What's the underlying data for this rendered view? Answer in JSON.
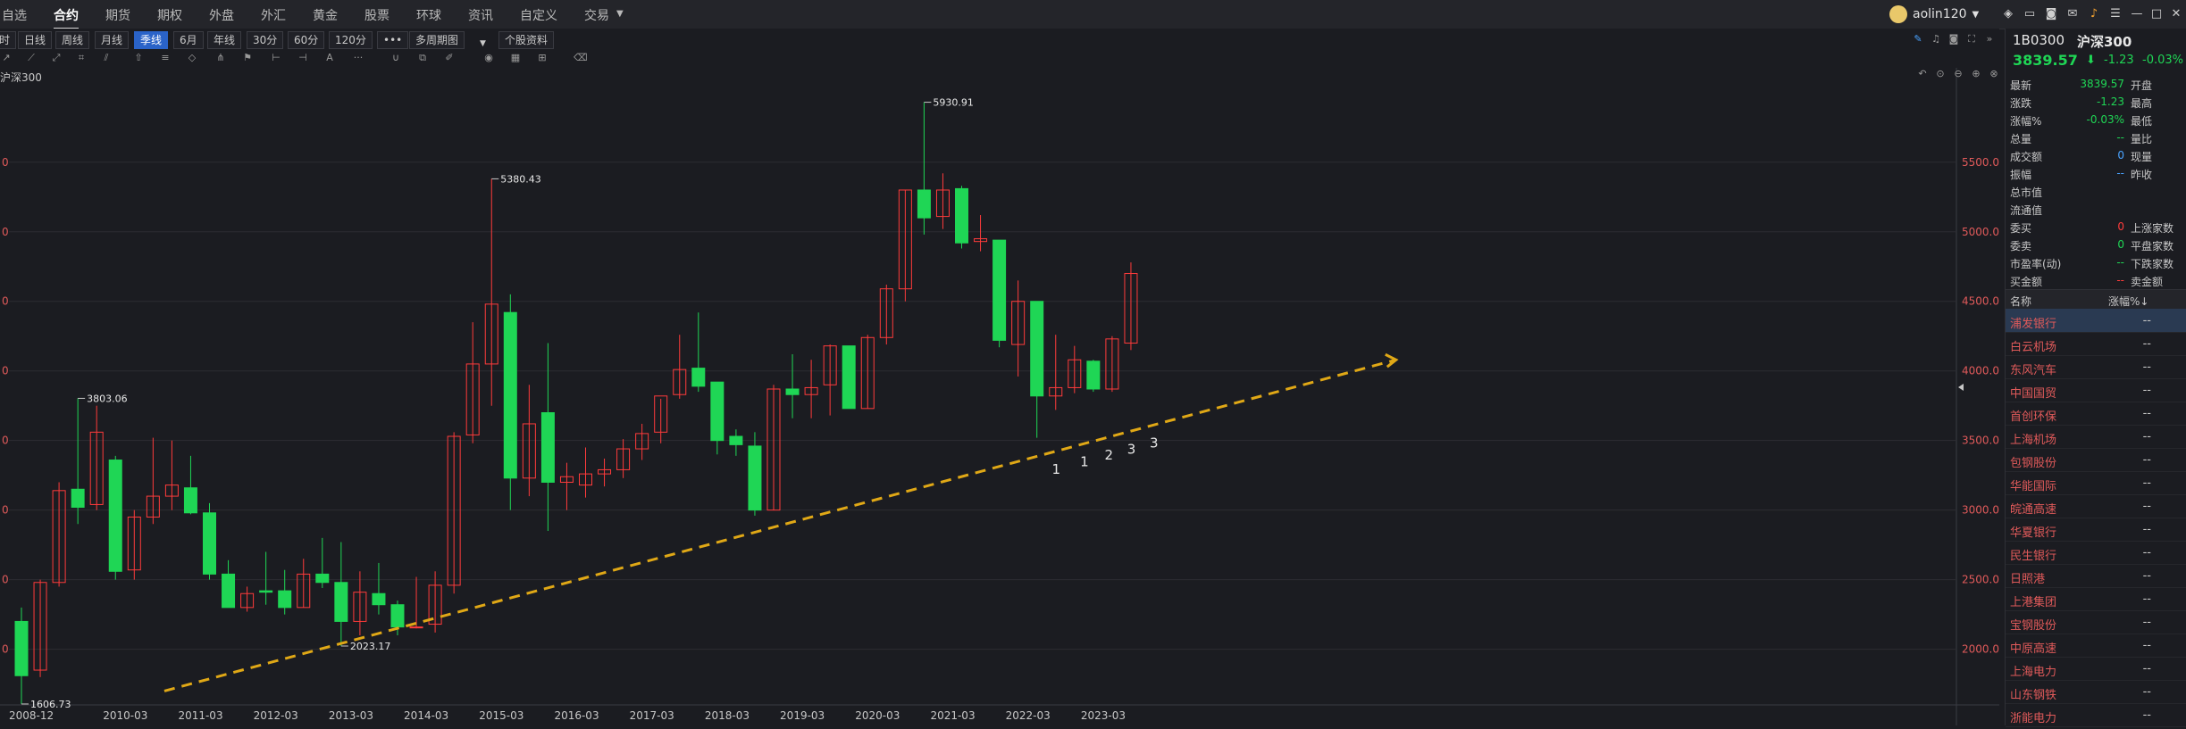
{
  "nav": {
    "items": [
      "自选",
      "合约",
      "期货",
      "期权",
      "外盘",
      "外汇",
      "黄金",
      "股票",
      "环球",
      "资讯",
      "自定义",
      "交易"
    ],
    "active": "合约",
    "user": "aolin120"
  },
  "periods": {
    "items": [
      "分时",
      "日线",
      "周线",
      "月线",
      "季线",
      "6月",
      "年线",
      "30分",
      "60分",
      "120分",
      "•••",
      "多周期图",
      "个股资料"
    ],
    "active": "季线"
  },
  "chart": {
    "label": "沪深300",
    "colors": {
      "up": "#ff3b3b",
      "down": "#1fd655",
      "trend": "#e0a816",
      "bg": "#1b1c21",
      "grid": "#2c2d33"
    }
  },
  "chart_data": {
    "type": "candlestick",
    "title": "沪深300",
    "x_ticks": [
      "2008-12",
      "2010-03",
      "2011-03",
      "2012-03",
      "2013-03",
      "2014-03",
      "2015-03",
      "2016-03",
      "2017-03",
      "2018-03",
      "2019-03",
      "2020-03",
      "2021-03",
      "2022-03",
      "2023-03"
    ],
    "y_ticks": [
      2000,
      2500,
      3000,
      3500,
      4000,
      4500,
      5000,
      5500
    ],
    "ylim": [
      1600,
      6050
    ],
    "candles": [
      {
        "o": 2200,
        "h": 2300,
        "l": 1606.73,
        "c": 1810
      },
      {
        "o": 1850,
        "h": 2500,
        "l": 1800,
        "c": 2480
      },
      {
        "o": 2480,
        "h": 3200,
        "l": 2450,
        "c": 3140
      },
      {
        "o": 3150,
        "h": 3803.06,
        "l": 2900,
        "c": 3020
      },
      {
        "o": 3040,
        "h": 3750,
        "l": 3000,
        "c": 3560
      },
      {
        "o": 3360,
        "h": 3390,
        "l": 2500,
        "c": 2560
      },
      {
        "o": 2570,
        "h": 3000,
        "l": 2500,
        "c": 2950
      },
      {
        "o": 2950,
        "h": 3520,
        "l": 2900,
        "c": 3100
      },
      {
        "o": 3100,
        "h": 3500,
        "l": 3000,
        "c": 3180
      },
      {
        "o": 3160,
        "h": 3390,
        "l": 2970,
        "c": 2980
      },
      {
        "o": 2980,
        "h": 3050,
        "l": 2500,
        "c": 2540
      },
      {
        "o": 2540,
        "h": 2640,
        "l": 2340,
        "c": 2300
      },
      {
        "o": 2300,
        "h": 2450,
        "l": 2270,
        "c": 2400
      },
      {
        "o": 2420,
        "h": 2700,
        "l": 2320,
        "c": 2410
      },
      {
        "o": 2420,
        "h": 2570,
        "l": 2250,
        "c": 2300
      },
      {
        "o": 2300,
        "h": 2650,
        "l": 2300,
        "c": 2540
      },
      {
        "o": 2540,
        "h": 2800,
        "l": 2440,
        "c": 2480
      },
      {
        "o": 2480,
        "h": 2770,
        "l": 2023.17,
        "c": 2200
      },
      {
        "o": 2200,
        "h": 2560,
        "l": 2100,
        "c": 2410
      },
      {
        "o": 2400,
        "h": 2620,
        "l": 2250,
        "c": 2320
      },
      {
        "o": 2320,
        "h": 2350,
        "l": 2100,
        "c": 2160
      },
      {
        "o": 2160,
        "h": 2520,
        "l": 2150,
        "c": 2160
      },
      {
        "o": 2180,
        "h": 2560,
        "l": 2120,
        "c": 2460
      },
      {
        "o": 2460,
        "h": 3560,
        "l": 2400,
        "c": 3530
      },
      {
        "o": 3540,
        "h": 4350,
        "l": 3480,
        "c": 4050
      },
      {
        "o": 4050,
        "h": 5380.43,
        "l": 3750,
        "c": 4480
      },
      {
        "o": 4420,
        "h": 4550,
        "l": 3000,
        "c": 3230
      },
      {
        "o": 3230,
        "h": 3900,
        "l": 3100,
        "c": 3620
      },
      {
        "o": 3700,
        "h": 4200,
        "l": 2850,
        "c": 3200
      },
      {
        "o": 3200,
        "h": 3340,
        "l": 3000,
        "c": 3240
      },
      {
        "o": 3180,
        "h": 3450,
        "l": 3090,
        "c": 3260
      },
      {
        "o": 3260,
        "h": 3370,
        "l": 3170,
        "c": 3290
      },
      {
        "o": 3290,
        "h": 3510,
        "l": 3230,
        "c": 3440
      },
      {
        "o": 3440,
        "h": 3620,
        "l": 3360,
        "c": 3550
      },
      {
        "o": 3560,
        "h": 3800,
        "l": 3480,
        "c": 3820
      },
      {
        "o": 3830,
        "h": 4260,
        "l": 3800,
        "c": 4010
      },
      {
        "o": 4020,
        "h": 4420,
        "l": 3850,
        "c": 3890
      },
      {
        "o": 3920,
        "h": 3920,
        "l": 3400,
        "c": 3500
      },
      {
        "o": 3530,
        "h": 3580,
        "l": 3390,
        "c": 3470
      },
      {
        "o": 3460,
        "h": 3560,
        "l": 2960,
        "c": 3000
      },
      {
        "o": 3000,
        "h": 3900,
        "l": 3000,
        "c": 3870
      },
      {
        "o": 3870,
        "h": 4120,
        "l": 3660,
        "c": 3830
      },
      {
        "o": 3830,
        "h": 4080,
        "l": 3660,
        "c": 3880
      },
      {
        "o": 3900,
        "h": 4190,
        "l": 3680,
        "c": 4180
      },
      {
        "o": 4180,
        "h": 4180,
        "l": 3730,
        "c": 3730
      },
      {
        "o": 3730,
        "h": 4260,
        "l": 3730,
        "c": 4240
      },
      {
        "o": 4240,
        "h": 4620,
        "l": 4190,
        "c": 4590
      },
      {
        "o": 4590,
        "h": 5300,
        "l": 4500,
        "c": 5300
      },
      {
        "o": 5300,
        "h": 5930.91,
        "l": 4980,
        "c": 5100
      },
      {
        "o": 5110,
        "h": 5420,
        "l": 5020,
        "c": 5300
      },
      {
        "o": 5310,
        "h": 5330,
        "l": 4880,
        "c": 4920
      },
      {
        "o": 4930,
        "h": 5120,
        "l": 4860,
        "c": 4950
      },
      {
        "o": 4940,
        "h": 4940,
        "l": 4170,
        "c": 4220
      },
      {
        "o": 4190,
        "h": 4650,
        "l": 3960,
        "c": 4500
      },
      {
        "o": 4500,
        "h": 4500,
        "l": 3520,
        "c": 3820
      },
      {
        "o": 3820,
        "h": 4260,
        "l": 3720,
        "c": 3880
      },
      {
        "o": 3880,
        "h": 4180,
        "l": 3840,
        "c": 4080
      },
      {
        "o": 4070,
        "h": 4080,
        "l": 3850,
        "c": 3870
      },
      {
        "o": 3870,
        "h": 4250,
        "l": 3850,
        "c": 4230
      },
      {
        "o": 4200,
        "h": 4780,
        "l": 4150,
        "c": 4700
      }
    ],
    "annotations": [
      {
        "text": "1606.73",
        "x": 0,
        "y": 1606.73
      },
      {
        "text": "3803.06",
        "x": 3,
        "y": 3803.06
      },
      {
        "text": "2023.17",
        "x": 17,
        "y": 2023.17
      },
      {
        "text": "5380.43",
        "x": 25,
        "y": 5380.43
      },
      {
        "text": "5930.91",
        "x": 48,
        "y": 5930.91
      }
    ],
    "wave_labels": [
      {
        "text": "1",
        "x": 54.8
      },
      {
        "text": "1",
        "x": 56.3
      },
      {
        "text": "2",
        "x": 57.6
      },
      {
        "text": "3",
        "x": 58.8
      },
      {
        "text": "3",
        "x": 60.0
      }
    ],
    "trendline": {
      "from": {
        "x": 7.6,
        "y": 1700
      },
      "to": {
        "x": 73.1,
        "y": 4080
      }
    }
  },
  "quote": {
    "code": "1B0300",
    "name": "沪深300",
    "price": "3839.57",
    "change": "-1.23",
    "change_pct": "-0.03%",
    "rows": [
      {
        "l": "最新",
        "v": "3839.57",
        "r": "开盘",
        "c": "#1fd655"
      },
      {
        "l": "涨跌",
        "v": "-1.23",
        "r": "最高",
        "c": "#1fd655"
      },
      {
        "l": "涨幅%",
        "v": "-0.03%",
        "r": "最低",
        "c": "#1fd655"
      },
      {
        "l": "总量",
        "v": "--",
        "r": "量比",
        "c": "#1fd655"
      },
      {
        "l": "成交额",
        "v": "0",
        "r": "现量",
        "c": "#4aa3ff"
      },
      {
        "l": "振幅",
        "v": "--",
        "r": "昨收",
        "c": "#4aa3ff"
      },
      {
        "l": "总市值",
        "v": "",
        "r": "",
        "c": "#c8c8c8"
      },
      {
        "l": "流通值",
        "v": "",
        "r": "",
        "c": "#c8c8c8"
      },
      {
        "l": "委买",
        "v": "0",
        "r": "上涨家数",
        "c": "#ff3b3b"
      },
      {
        "l": "委卖",
        "v": "0",
        "r": "平盘家数",
        "c": "#1fd655"
      },
      {
        "l": "市盈率(动)",
        "v": "--",
        "r": "下跌家数",
        "c": "#1fd655"
      },
      {
        "l": "买金额",
        "v": "--",
        "r": "卖金额",
        "c": "#ff3b3b"
      }
    ],
    "list_header": {
      "name": "名称",
      "pct": "涨幅%↓"
    },
    "stocks": [
      "浦发银行",
      "白云机场",
      "东风汽车",
      "中国国贸",
      "首创环保",
      "上海机场",
      "包钢股份",
      "华能国际",
      "皖通高速",
      "华夏银行",
      "民生银行",
      "日照港",
      "上港集团",
      "宝钢股份",
      "中原高速",
      "上海电力",
      "山东钢铁",
      "浙能电力"
    ],
    "stock_val": "--"
  }
}
